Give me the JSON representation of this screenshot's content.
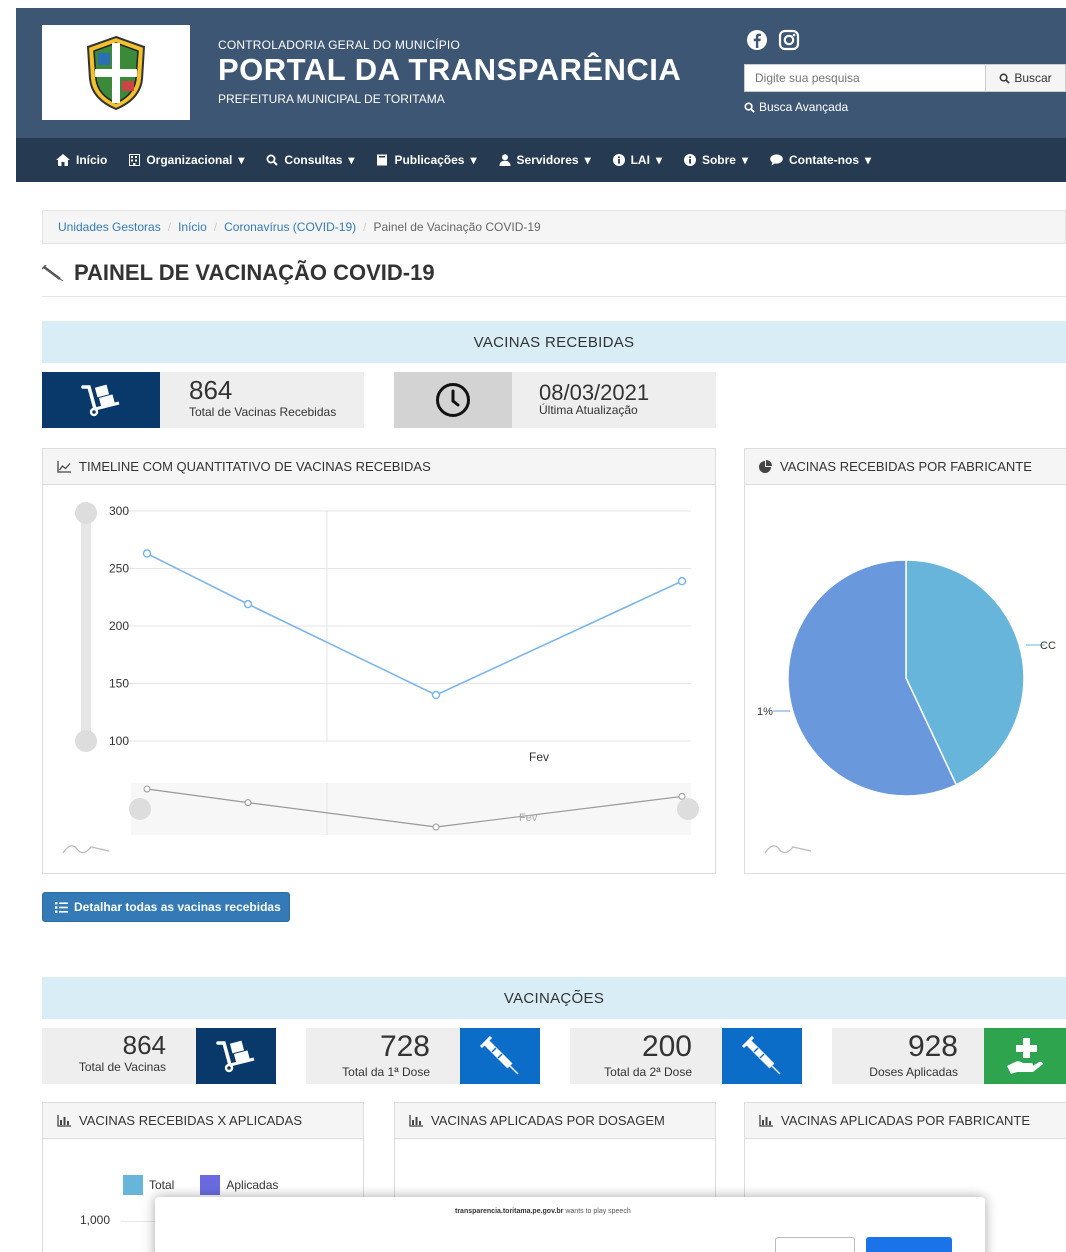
{
  "header": {
    "subtitle_top": "CONTROLADORIA GERAL DO MUNICÍPIO",
    "title": "PORTAL DA TRANSPARÊNCIA",
    "subtitle_bottom": "PREFEITURA MUNICIPAL DE TORITAMA",
    "search_placeholder": "Digite sua pesquisa",
    "search_button": "Buscar",
    "advanced_search": "Busca Avançada"
  },
  "nav": {
    "items": [
      {
        "label": "Início",
        "icon": "home-icon"
      },
      {
        "label": "Organizacional",
        "icon": "building-icon",
        "caret": true
      },
      {
        "label": "Consultas",
        "icon": "search-icon",
        "caret": true
      },
      {
        "label": "Publicações",
        "icon": "book-icon",
        "caret": true
      },
      {
        "label": "Servidores",
        "icon": "user-icon",
        "caret": true
      },
      {
        "label": "LAI",
        "icon": "info-icon",
        "caret": true
      },
      {
        "label": "Sobre",
        "icon": "info-icon",
        "caret": true
      },
      {
        "label": "Contate-nos",
        "icon": "comment-icon",
        "caret": true
      }
    ]
  },
  "breadcrumb": {
    "items": [
      "Unidades Gestoras",
      "Início",
      "Coronavírus (COVID-19)"
    ],
    "current": "Painel de Vacinação COVID-19"
  },
  "page_title": "PAINEL DE VACINAÇÃO COVID-19",
  "received": {
    "section_title": "VACINAS RECEBIDAS",
    "total_value": "864",
    "total_label": "Total de Vacinas Recebidas",
    "update_value": "08/03/2021",
    "update_label": "Última Atualização",
    "timeline_title": "TIMELINE COM QUANTITATIVO DE VACINAS RECEBIDAS",
    "manufacturer_title": "VACINAS RECEBIDAS POR FABRICANTE",
    "detail_button": "Detalhar todas as vacinas recebidas",
    "pie_label_right": "CC",
    "pie_label_left": "1%"
  },
  "vaccinations": {
    "section_title": "VACINAÇÕES",
    "cards": [
      {
        "value": "864",
        "label": "Total de Vacinas",
        "color": "#08396a",
        "icon": "dolly-icon"
      },
      {
        "value": "728",
        "label": "Total da 1ª Dose",
        "color": "#0b6dc7",
        "icon": "syringe-icon"
      },
      {
        "value": "200",
        "label": "Total da 2ª Dose",
        "color": "#0b6dc7",
        "icon": "syringe-icon"
      },
      {
        "value": "928",
        "label": "Doses Aplicadas",
        "color": "#2ea44f",
        "icon": "hand-plus-icon"
      }
    ],
    "panels": [
      "VACINAS RECEBIDAS X APLICADAS",
      "VACINAS APLICADAS POR DOSAGEM",
      "VACINAS APLICADAS POR FABRICANTE"
    ],
    "legend": [
      "Total",
      "Aplicadas"
    ],
    "y_first_tick": "1,000"
  },
  "dialog": {
    "site": "transparencia.toritama.pe.gov.br",
    "message": " wants to play speech"
  },
  "colors": {
    "header": "#3d5673",
    "nav": "#263a52",
    "line": "#7cb5ec",
    "pie_a": "#6a98dc",
    "pie_b": "#68b5dc"
  },
  "chart_data": [
    {
      "type": "line",
      "title": "TIMELINE COM QUANTITATIVO DE VACINAS RECEBIDAS",
      "x_tick_label": "Fev",
      "y_ticks": [
        100,
        150,
        200,
        250,
        300
      ],
      "ylim": [
        100,
        300
      ],
      "series": [
        {
          "values": [
            263,
            219,
            140,
            239
          ]
        }
      ],
      "grid": true
    },
    {
      "type": "pie",
      "title": "VACINAS RECEBIDAS POR FABRICANTE",
      "slices": [
        {
          "value": 57,
          "color": "#6a98dc"
        },
        {
          "value": 43,
          "color": "#68b5dc"
        }
      ]
    }
  ]
}
